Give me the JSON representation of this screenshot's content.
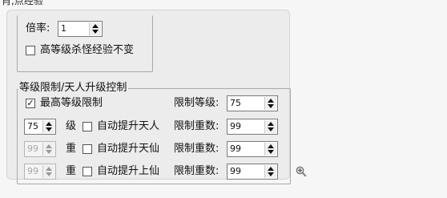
{
  "top_fragment": "肖,点经验",
  "rate": {
    "label": "倍率:",
    "value": "1"
  },
  "highlevel_exp": {
    "label": "高等级杀怪经验不变",
    "checked": false
  },
  "group": {
    "legend": "等级限制/天人升级控制",
    "max_level": {
      "label": "最高等级限制",
      "checked": true
    },
    "limit_level": {
      "label": "限制等级:",
      "value": "75"
    },
    "rows": [
      {
        "value": "75",
        "unit": "级",
        "check_label": "自动提升天人",
        "limit_label": "限制重数:",
        "limit_value": "99",
        "disabled": false
      },
      {
        "value": "99",
        "unit": "重",
        "check_label": "自动提升天仙",
        "limit_label": "限制重数:",
        "limit_value": "99",
        "disabled": true
      },
      {
        "value": "99",
        "unit": "重",
        "check_label": "自动提升上仙",
        "limit_label": "限制重数:",
        "limit_value": "99",
        "disabled": true
      }
    ]
  },
  "icons": {
    "zoom": "zoom-in-icon"
  }
}
